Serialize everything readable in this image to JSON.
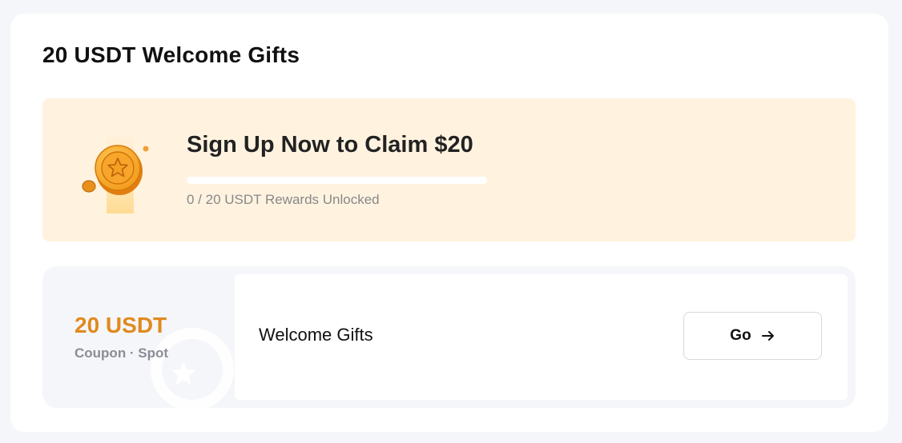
{
  "page": {
    "title": "20 USDT Welcome Gifts"
  },
  "banner": {
    "heading": "Sign Up Now to Claim $20",
    "progress_text": "0 / 20 USDT Rewards Unlocked",
    "progress_fraction": 0,
    "icon": "gold-coin-star-icon"
  },
  "coupon": {
    "amount": "20 USDT",
    "type": "Coupon · Spot",
    "name": "Welcome Gifts",
    "button_label": "Go",
    "button_icon": "arrow-right-icon"
  },
  "colors": {
    "accent": "#e08a1e",
    "banner_bg": "#fff3e0",
    "page_bg": "#f5f6fa"
  }
}
